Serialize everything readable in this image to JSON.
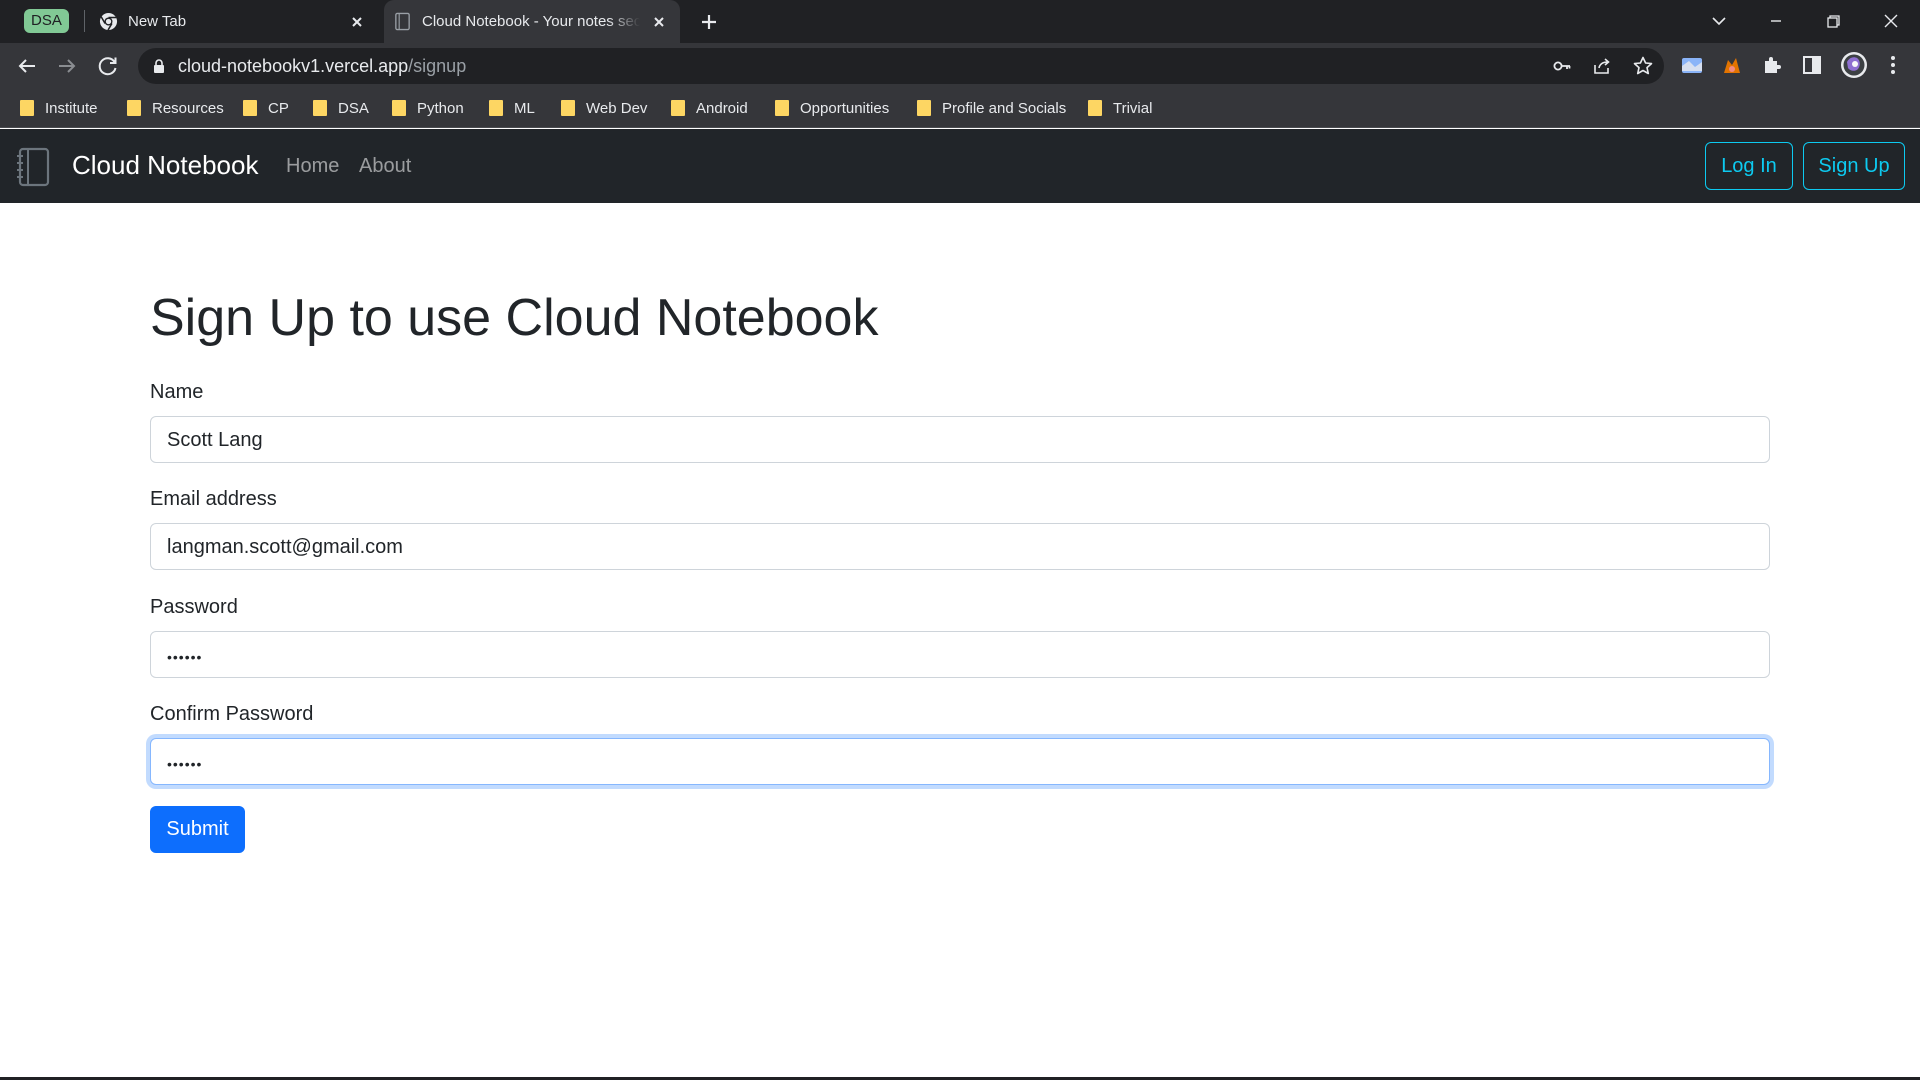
{
  "browser": {
    "tab_group_label": "DSA",
    "tabs": [
      {
        "title": "New Tab",
        "icon": "chrome-icon",
        "active": false
      },
      {
        "title": "Cloud Notebook - Your notes secured",
        "icon": "notebook-favicon",
        "active": true
      }
    ],
    "url_host": "cloud-notebookv1.vercel.app",
    "url_path": "/signup",
    "bookmarks": [
      "Institute",
      "Resources",
      "CP",
      "DSA",
      "Python",
      "ML",
      "Web Dev",
      "Android",
      "Opportunities",
      "Profile and Socials",
      "Trivial"
    ],
    "colors": {
      "chrome_dark": "#202124",
      "chrome_toolbar": "#35363a",
      "folder": "#fdd663",
      "group": "#81c995"
    }
  },
  "navbar": {
    "brand": "Cloud Notebook",
    "links": [
      "Home",
      "About"
    ],
    "login_label": "Log In",
    "signup_label": "Sign Up",
    "colors": {
      "background": "#212529",
      "outline_accent": "#0dcaf0"
    }
  },
  "form": {
    "title": "Sign Up to use Cloud Notebook",
    "fields": [
      {
        "label": "Name",
        "value": "Scott Lang",
        "type": "text"
      },
      {
        "label": "Email address",
        "value": "langman.scott@gmail.com",
        "type": "email"
      },
      {
        "label": "Password",
        "value": "••••••",
        "type": "password"
      },
      {
        "label": "Confirm Password",
        "value": "••••••",
        "type": "password",
        "focused": true
      }
    ],
    "submit_label": "Submit",
    "colors": {
      "primary": "#0d6efd",
      "focus_border": "#86b7fe"
    }
  }
}
